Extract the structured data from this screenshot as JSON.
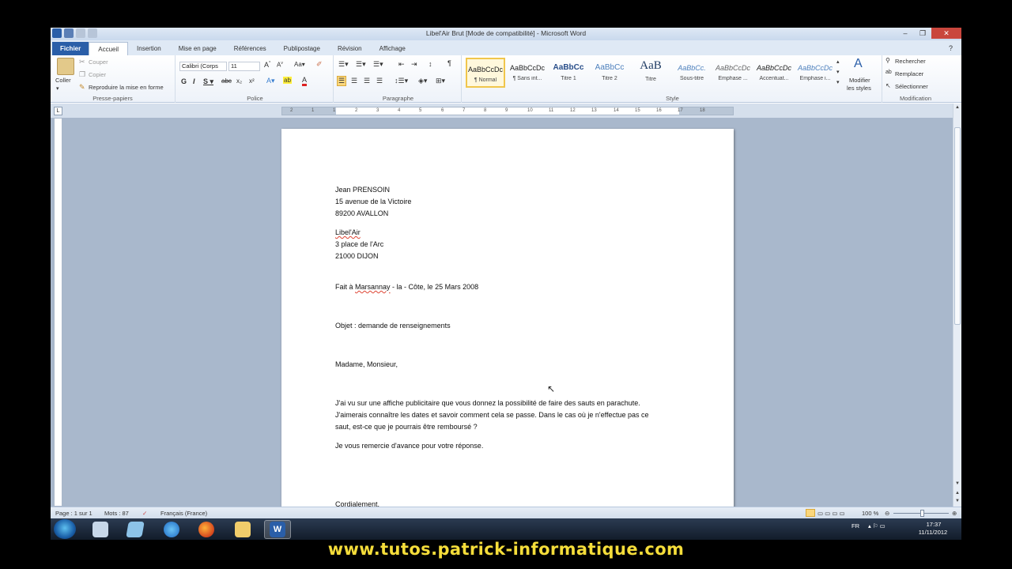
{
  "window": {
    "title": "Libel'Air Brut [Mode de compatibilité] - Microsoft Word"
  },
  "tabs": [
    "Fichier",
    "Accueil",
    "Insertion",
    "Mise en page",
    "Références",
    "Publipostage",
    "Révision",
    "Affichage"
  ],
  "ribbon": {
    "clipboard": {
      "paste_label": "Coller",
      "cut_label": "Couper",
      "copy_label": "Copier",
      "format_painter_label": "Reproduire la mise en forme",
      "group_label": "Presse-papiers"
    },
    "font": {
      "font_name": "Calibri (Corps",
      "font_size": "11",
      "group_label": "Police"
    },
    "paragraph": {
      "group_label": "Paragraphe"
    },
    "styles": {
      "items": [
        {
          "sample": "AaBbCcDc",
          "name": "¶ Normal"
        },
        {
          "sample": "AaBbCcDc",
          "name": "¶ Sans int..."
        },
        {
          "sample": "AaBbCc",
          "name": "Titre 1"
        },
        {
          "sample": "AaBbCc",
          "name": "Titre 2"
        },
        {
          "sample": "AaB",
          "name": "Titre"
        },
        {
          "sample": "AaBbCc.",
          "name": "Sous-titre"
        },
        {
          "sample": "AaBbCcDc",
          "name": "Emphase ..."
        },
        {
          "sample": "AaBbCcDc",
          "name": "Accentuat..."
        },
        {
          "sample": "AaBbCcDc",
          "name": "Emphase i..."
        }
      ],
      "modify_label_1": "Modifier",
      "modify_label_2": "les styles",
      "group_label": "Style"
    },
    "editing": {
      "find_label": "Rechercher",
      "replace_label": "Remplacer",
      "select_label": "Sélectionner",
      "group_label": "Modification"
    }
  },
  "ruler": {
    "labels": [
      "2",
      "1",
      "1",
      "2",
      "3",
      "4",
      "5",
      "6",
      "7",
      "8",
      "9",
      "10",
      "11",
      "12",
      "13",
      "14",
      "15",
      "16",
      "17",
      "18"
    ]
  },
  "document": {
    "sender": [
      "Jean PRENSOIN",
      "15 avenue de la Victoire",
      "89200  AVALLON"
    ],
    "recipient": [
      "Libel'Air",
      "3 place de l'Arc",
      "21000  DIJON"
    ],
    "date_prefix": "Fait à ",
    "date_place": "Marsannay",
    "date_suffix": " - la - Côte, le 25 Mars 2008",
    "subject": "Objet : demande de renseignements",
    "greeting": "Madame, Monsieur,",
    "body": [
      "J'ai vu sur une affiche publicitaire que vous donnez la possibilité de faire des sauts en parachute.",
      "J'aimerais connaître les dates et savoir comment cela se passe. Dans le cas où je n'effectue pas ce",
      "saut, est-ce que je pourrais être remboursé ?"
    ],
    "thanks": "Je vous remercie d'avance pour votre réponse.",
    "closing": "Cordialement."
  },
  "statusbar": {
    "page": "Page : 1 sur 1",
    "words": "Mots : 87",
    "language": "Français (France)",
    "zoom": "100 %"
  },
  "taskbar": {
    "lang": "FR",
    "time": "17:37",
    "date": "11/11/2012"
  },
  "footer": "www.tutos.patrick-informatique.com",
  "colors": {
    "file_tab": "#2a5ea8",
    "footer_text": "#f5dd3a",
    "selected_style": "#f0c64c"
  }
}
